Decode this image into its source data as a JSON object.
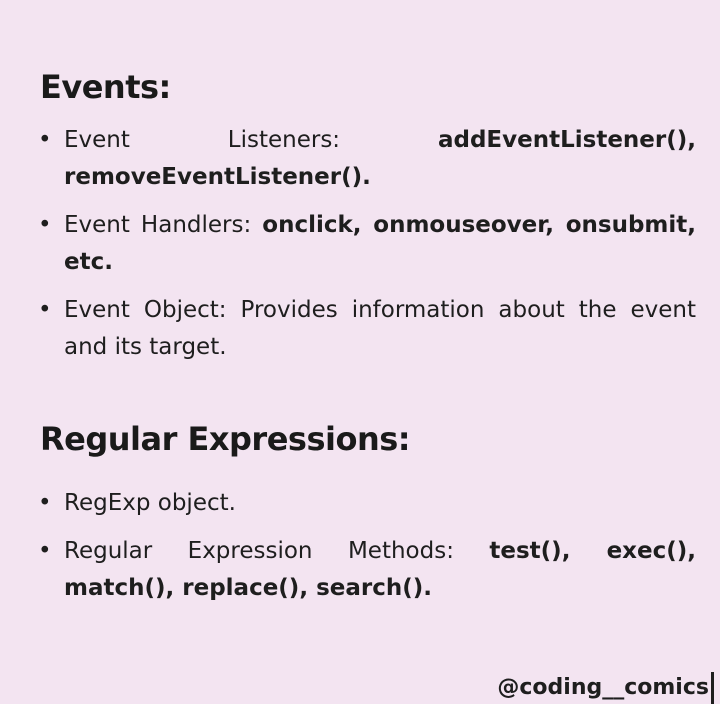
{
  "events": {
    "heading": "Events:",
    "listeners": {
      "label": "Event Listeners:",
      "methods_line1": "addEventListener(),",
      "methods_line2": "removeEventListener()."
    },
    "handlers": {
      "label": "Event Handlers:",
      "values": "onclick, onmouseover, onsubmit, etc."
    },
    "object": {
      "text": "Event Object: Provides information about the event and its target."
    }
  },
  "regex": {
    "heading": "Regular Expressions:",
    "object_text": "RegExp object.",
    "methods": {
      "label": "Regular Expression Methods:",
      "values": "test(), exec(), match(), replace(), search()."
    }
  },
  "bullet_symbol": "•",
  "footer": {
    "handle": "@coding__comics"
  }
}
